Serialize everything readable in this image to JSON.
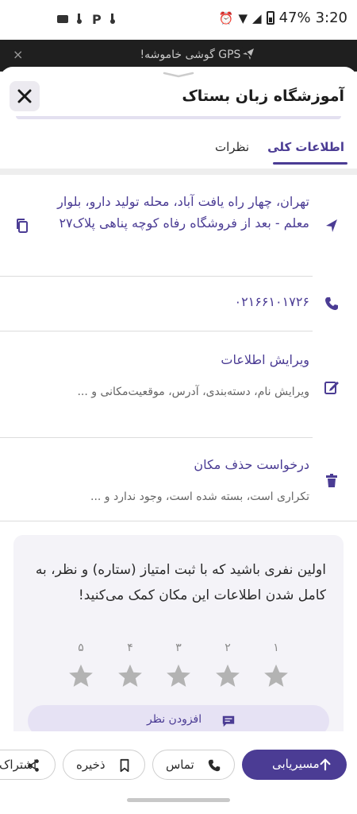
{
  "status_bar": {
    "left_icons_text": "و آ ِ",
    "battery": "47%",
    "time": "3:20"
  },
  "gps_banner": {
    "text": "GPS گوشی خاموشه!",
    "close": "×"
  },
  "sheet": {
    "title": "آموزشگاه زبان بستاک",
    "close_label": "×"
  },
  "tabs": [
    {
      "label": "اطلاعات کلی",
      "active": true
    },
    {
      "label": "نظرات",
      "active": false
    }
  ],
  "address": {
    "text": "تهران، چهار راه یافت آباد، محله تولید دارو، بلوار معلم - بعد از فروشگاه رفاه کوچه پناهی پلاک۲۷"
  },
  "phone": {
    "text": "۰۲۱۶۶۱۰۱۷۲۶"
  },
  "edit_info": {
    "title": "ویرایش اطلاعات",
    "subtitle": "ویرایش نام، دسته‌بندی، آدرس، موقعیت‌مکانی و ..."
  },
  "delete_request": {
    "title": "درخواست حذف مکان",
    "subtitle": "تکراری است، بسته شده است، وجود ندارد و ..."
  },
  "rating": {
    "prompt": "اولین نفری باشید که با ثبت امتیاز (ستاره) و نظر، به کامل شدن اطلاعات این مکان کمک می‌کنید!",
    "stars": [
      "۱",
      "۲",
      "۳",
      "۴",
      "۵"
    ],
    "add_review_label": "افزودن نظر"
  },
  "bottom_actions": {
    "navigate": "مسیریابی",
    "call": "تماس",
    "save": "ذخیره",
    "share": "اشتراک"
  },
  "colors": {
    "accent": "#4b3c94",
    "star": "#b3b3b3"
  }
}
